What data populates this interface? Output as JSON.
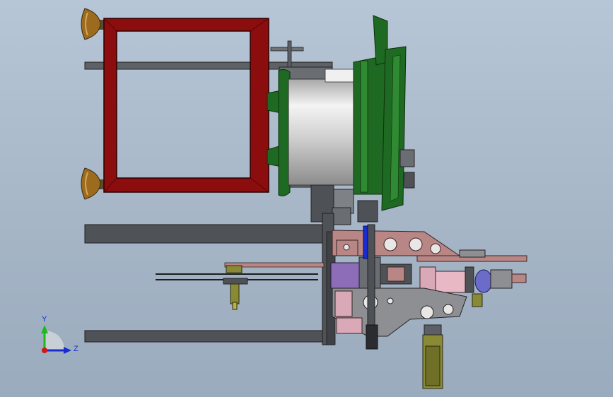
{
  "scene": {
    "view_type": "cad-assembly-side-view",
    "background_color": "#a9b8c9",
    "colors": {
      "red_frame": "#8b0d0d",
      "frame_steel": "#4f5358",
      "drum_silver": "#d8d8d8",
      "drum_green": "#1f6a22",
      "plate_pink": "#b98686",
      "plate_gray": "#8d8f93",
      "bracket_violet": "#8e6db8",
      "roller_pink": "#d9a9b7",
      "motor_olive": "#8a8a36",
      "foot_bronze": "#9c6b1e"
    }
  },
  "triad": {
    "y_label": "Y",
    "z_label": "Z",
    "y_color": "#1fb81f",
    "z_color": "#1a2bd0",
    "origin_color": "#d01818"
  }
}
